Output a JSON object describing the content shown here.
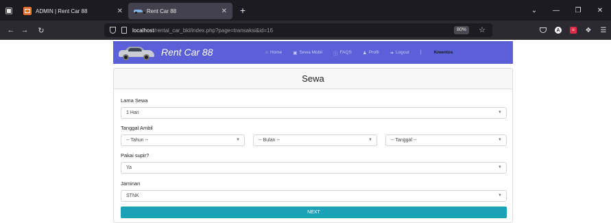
{
  "browser": {
    "tabs": [
      {
        "title": "ADMIN | Rent Car 88",
        "active": false
      },
      {
        "title": "Rent Car 88",
        "active": true
      }
    ],
    "url_host": "localhost",
    "url_path": "/rental_car_bkl/index.php?page=transaksi&id=16",
    "zoom": "80%"
  },
  "site": {
    "brand": "Rent Car 88",
    "nav": [
      {
        "icon": "home-icon",
        "label": "Home"
      },
      {
        "icon": "car-icon",
        "label": "Sewa Mobil"
      },
      {
        "icon": "question-icon",
        "label": "FAQS"
      },
      {
        "icon": "user-icon",
        "label": "Profil"
      },
      {
        "icon": "logout-icon",
        "label": "Logout"
      }
    ],
    "nav_separator": "|",
    "username": "Kmentos"
  },
  "form": {
    "title": "Sewa",
    "lama_sewa": {
      "label": "Lama Sewa",
      "value": "1 Hari"
    },
    "tanggal_ambil": {
      "label": "Tanggal Ambil",
      "tahun": "-- Tahun --",
      "bulan": "-- Bulan --",
      "tanggal": "-- Tanggal --"
    },
    "supir": {
      "label": "Pakai supir?",
      "value": "Ya"
    },
    "jaminan": {
      "label": "Jaminan",
      "value": "STNK"
    },
    "next_label": "NEXT"
  },
  "colors": {
    "navbar": "#5b60d8",
    "next_button": "#1ba2b7",
    "browser_dark": "#1c1b22"
  }
}
